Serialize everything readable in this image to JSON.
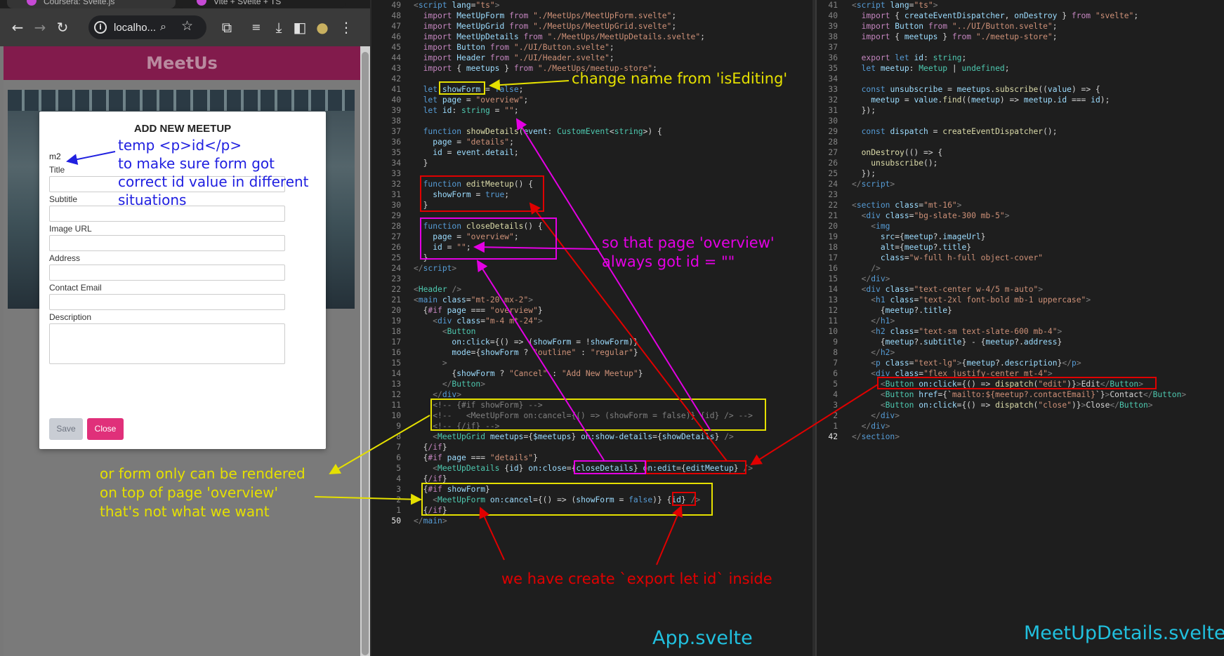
{
  "browser": {
    "tabs": [
      {
        "label": "Coursera: Svelte.js"
      },
      {
        "label": "Vite + Svelte + TS"
      }
    ],
    "toolbar": {
      "back_icon": "arrow-left-icon",
      "forward_icon": "arrow-right-icon",
      "reload_icon": "reload-icon",
      "url": "localho...",
      "actions": [
        "extensions-icon",
        "reading-list-icon",
        "download-icon",
        "sidepanel-icon",
        "profile-icon",
        "kebab-menu-icon"
      ]
    },
    "app_title": "MeetUs",
    "modal": {
      "title": "ADD NEW MEETUP",
      "id_text": "m2",
      "fields": [
        {
          "label": "Title",
          "value": ""
        },
        {
          "label": "Subtitle",
          "value": ""
        },
        {
          "label": "Image URL",
          "value": ""
        },
        {
          "label": "Address",
          "value": ""
        },
        {
          "label": "Contact Email",
          "value": ""
        },
        {
          "label": "Description",
          "value": ""
        }
      ],
      "save_label": "Save",
      "close_label": "Close"
    }
  },
  "annotations": {
    "temp_id": [
      "temp <p>id</p>",
      "to make sure form got",
      "correct id value in different",
      "situations"
    ],
    "rename": "change name from 'isEditing'",
    "always_id": [
      "so that page 'overview'",
      "always got id = \"\""
    ],
    "overview_only": [
      "or form only can be rendered",
      "on top of page 'overview'",
      "that's not what we want"
    ],
    "export_id": "we have create `export let id` inside"
  },
  "files": {
    "left": "App.svelte",
    "right": "MeetUpDetails.svelte"
  },
  "colors": {
    "annotation_blue": "#2020e0",
    "annotation_yellow": "#e5e000",
    "annotation_magenta": "#e400e4",
    "annotation_red": "#e00000",
    "filename": "#21c0de",
    "header": "#821b4c",
    "close_button": "#e0307a"
  }
}
